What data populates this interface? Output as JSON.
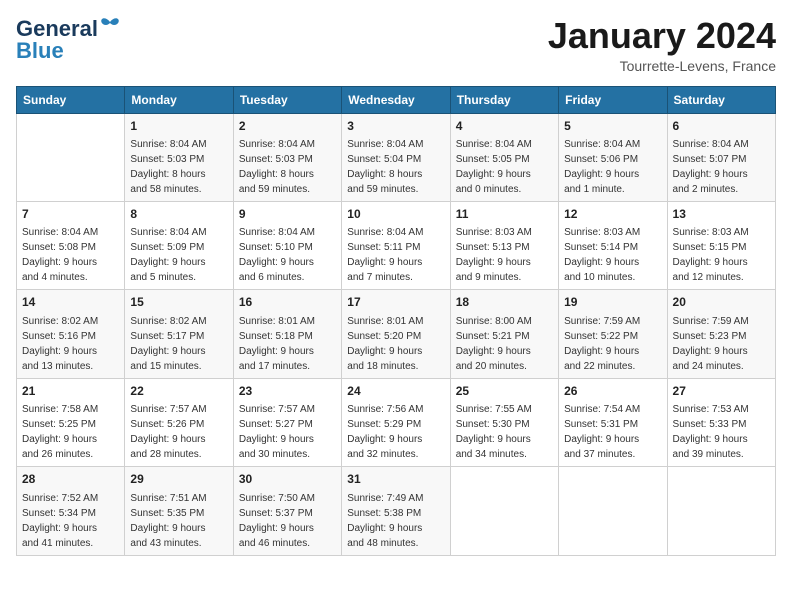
{
  "header": {
    "logo_general": "General",
    "logo_blue": "Blue",
    "title": "January 2024",
    "subtitle": "Tourrette-Levens, France"
  },
  "days_of_week": [
    "Sunday",
    "Monday",
    "Tuesday",
    "Wednesday",
    "Thursday",
    "Friday",
    "Saturday"
  ],
  "weeks": [
    [
      {
        "day": "",
        "info": ""
      },
      {
        "day": "1",
        "info": "Sunrise: 8:04 AM\nSunset: 5:03 PM\nDaylight: 8 hours\nand 58 minutes."
      },
      {
        "day": "2",
        "info": "Sunrise: 8:04 AM\nSunset: 5:03 PM\nDaylight: 8 hours\nand 59 minutes."
      },
      {
        "day": "3",
        "info": "Sunrise: 8:04 AM\nSunset: 5:04 PM\nDaylight: 8 hours\nand 59 minutes."
      },
      {
        "day": "4",
        "info": "Sunrise: 8:04 AM\nSunset: 5:05 PM\nDaylight: 9 hours\nand 0 minutes."
      },
      {
        "day": "5",
        "info": "Sunrise: 8:04 AM\nSunset: 5:06 PM\nDaylight: 9 hours\nand 1 minute."
      },
      {
        "day": "6",
        "info": "Sunrise: 8:04 AM\nSunset: 5:07 PM\nDaylight: 9 hours\nand 2 minutes."
      }
    ],
    [
      {
        "day": "7",
        "info": "Sunrise: 8:04 AM\nSunset: 5:08 PM\nDaylight: 9 hours\nand 4 minutes."
      },
      {
        "day": "8",
        "info": "Sunrise: 8:04 AM\nSunset: 5:09 PM\nDaylight: 9 hours\nand 5 minutes."
      },
      {
        "day": "9",
        "info": "Sunrise: 8:04 AM\nSunset: 5:10 PM\nDaylight: 9 hours\nand 6 minutes."
      },
      {
        "day": "10",
        "info": "Sunrise: 8:04 AM\nSunset: 5:11 PM\nDaylight: 9 hours\nand 7 minutes."
      },
      {
        "day": "11",
        "info": "Sunrise: 8:03 AM\nSunset: 5:13 PM\nDaylight: 9 hours\nand 9 minutes."
      },
      {
        "day": "12",
        "info": "Sunrise: 8:03 AM\nSunset: 5:14 PM\nDaylight: 9 hours\nand 10 minutes."
      },
      {
        "day": "13",
        "info": "Sunrise: 8:03 AM\nSunset: 5:15 PM\nDaylight: 9 hours\nand 12 minutes."
      }
    ],
    [
      {
        "day": "14",
        "info": "Sunrise: 8:02 AM\nSunset: 5:16 PM\nDaylight: 9 hours\nand 13 minutes."
      },
      {
        "day": "15",
        "info": "Sunrise: 8:02 AM\nSunset: 5:17 PM\nDaylight: 9 hours\nand 15 minutes."
      },
      {
        "day": "16",
        "info": "Sunrise: 8:01 AM\nSunset: 5:18 PM\nDaylight: 9 hours\nand 17 minutes."
      },
      {
        "day": "17",
        "info": "Sunrise: 8:01 AM\nSunset: 5:20 PM\nDaylight: 9 hours\nand 18 minutes."
      },
      {
        "day": "18",
        "info": "Sunrise: 8:00 AM\nSunset: 5:21 PM\nDaylight: 9 hours\nand 20 minutes."
      },
      {
        "day": "19",
        "info": "Sunrise: 7:59 AM\nSunset: 5:22 PM\nDaylight: 9 hours\nand 22 minutes."
      },
      {
        "day": "20",
        "info": "Sunrise: 7:59 AM\nSunset: 5:23 PM\nDaylight: 9 hours\nand 24 minutes."
      }
    ],
    [
      {
        "day": "21",
        "info": "Sunrise: 7:58 AM\nSunset: 5:25 PM\nDaylight: 9 hours\nand 26 minutes."
      },
      {
        "day": "22",
        "info": "Sunrise: 7:57 AM\nSunset: 5:26 PM\nDaylight: 9 hours\nand 28 minutes."
      },
      {
        "day": "23",
        "info": "Sunrise: 7:57 AM\nSunset: 5:27 PM\nDaylight: 9 hours\nand 30 minutes."
      },
      {
        "day": "24",
        "info": "Sunrise: 7:56 AM\nSunset: 5:29 PM\nDaylight: 9 hours\nand 32 minutes."
      },
      {
        "day": "25",
        "info": "Sunrise: 7:55 AM\nSunset: 5:30 PM\nDaylight: 9 hours\nand 34 minutes."
      },
      {
        "day": "26",
        "info": "Sunrise: 7:54 AM\nSunset: 5:31 PM\nDaylight: 9 hours\nand 37 minutes."
      },
      {
        "day": "27",
        "info": "Sunrise: 7:53 AM\nSunset: 5:33 PM\nDaylight: 9 hours\nand 39 minutes."
      }
    ],
    [
      {
        "day": "28",
        "info": "Sunrise: 7:52 AM\nSunset: 5:34 PM\nDaylight: 9 hours\nand 41 minutes."
      },
      {
        "day": "29",
        "info": "Sunrise: 7:51 AM\nSunset: 5:35 PM\nDaylight: 9 hours\nand 43 minutes."
      },
      {
        "day": "30",
        "info": "Sunrise: 7:50 AM\nSunset: 5:37 PM\nDaylight: 9 hours\nand 46 minutes."
      },
      {
        "day": "31",
        "info": "Sunrise: 7:49 AM\nSunset: 5:38 PM\nDaylight: 9 hours\nand 48 minutes."
      },
      {
        "day": "",
        "info": ""
      },
      {
        "day": "",
        "info": ""
      },
      {
        "day": "",
        "info": ""
      }
    ]
  ]
}
